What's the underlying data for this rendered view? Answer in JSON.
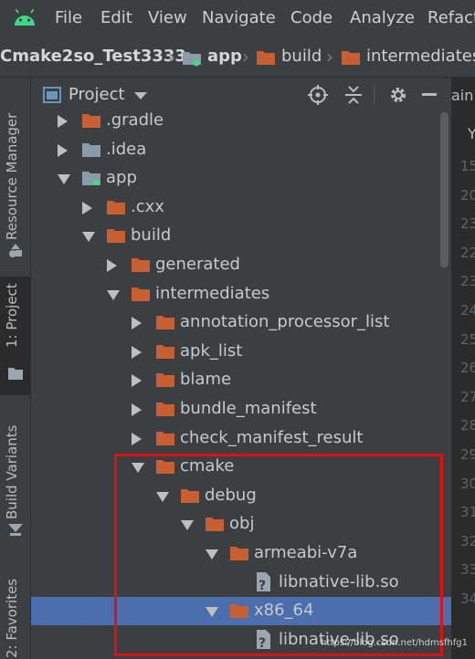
{
  "menu": {
    "items": [
      "File",
      "Edit",
      "View",
      "Navigate",
      "Code",
      "Analyze",
      "Refact"
    ]
  },
  "breadcrumb": {
    "items": [
      "Cmake2so_Test3333",
      "app",
      "build",
      "intermediates"
    ]
  },
  "sidebar": {
    "tabs": [
      {
        "label": "Resource Manager"
      },
      {
        "label": "1: Project"
      },
      {
        "label": "Build Variants"
      },
      {
        "label": "2: Favorites"
      }
    ]
  },
  "panel": {
    "title": "Project",
    "tree": [
      {
        "label": ".gradle",
        "state": "collapsed",
        "icon": "folder-orange-icon"
      },
      {
        "label": ".idea",
        "state": "collapsed",
        "icon": "folder-gray-icon"
      },
      {
        "label": "app",
        "state": "expanded",
        "icon": "module-folder-icon"
      },
      {
        "label": ".cxx",
        "state": "collapsed",
        "icon": "folder-orange-icon"
      },
      {
        "label": "build",
        "state": "expanded",
        "icon": "folder-orange-icon"
      },
      {
        "label": "generated",
        "state": "collapsed",
        "icon": "folder-orange-icon"
      },
      {
        "label": "intermediates",
        "state": "expanded",
        "icon": "folder-orange-icon"
      },
      {
        "label": "annotation_processor_list",
        "state": "collapsed",
        "icon": "folder-orange-icon"
      },
      {
        "label": "apk_list",
        "state": "collapsed",
        "icon": "folder-orange-icon"
      },
      {
        "label": "blame",
        "state": "collapsed",
        "icon": "folder-orange-icon"
      },
      {
        "label": "bundle_manifest",
        "state": "collapsed",
        "icon": "folder-orange-icon"
      },
      {
        "label": "check_manifest_result",
        "state": "collapsed",
        "icon": "folder-orange-icon"
      },
      {
        "label": "cmake",
        "state": "expanded",
        "icon": "folder-orange-icon"
      },
      {
        "label": "debug",
        "state": "expanded",
        "icon": "folder-orange-icon"
      },
      {
        "label": "obj",
        "state": "expanded",
        "icon": "folder-orange-icon"
      },
      {
        "label": "armeabi-v7a",
        "state": "expanded",
        "icon": "folder-orange-icon"
      },
      {
        "label": "libnative-lib.so",
        "state": "file",
        "icon": "unknown-file-icon"
      },
      {
        "label": "x86_64",
        "state": "expanded",
        "icon": "folder-orange-icon",
        "selected": true
      },
      {
        "label": "libnative-lib.so",
        "state": "file",
        "icon": "unknown-file-icon"
      }
    ]
  },
  "editor": {
    "tab_text": "ain.",
    "tab_letter": "Y",
    "gutter": [
      "15",
      "20",
      "23",
      "22",
      "23",
      "24",
      "25",
      "26",
      "27",
      "28",
      "29",
      "30",
      "31",
      "32",
      "33",
      "34"
    ]
  },
  "watermark": "https://blog.csdn.net/hdmsfhfg1",
  "colors": {
    "background": "#3c3f41",
    "selection": "#4b6eaf",
    "folder": "#c75f33",
    "highlight_box": "#e01010"
  }
}
